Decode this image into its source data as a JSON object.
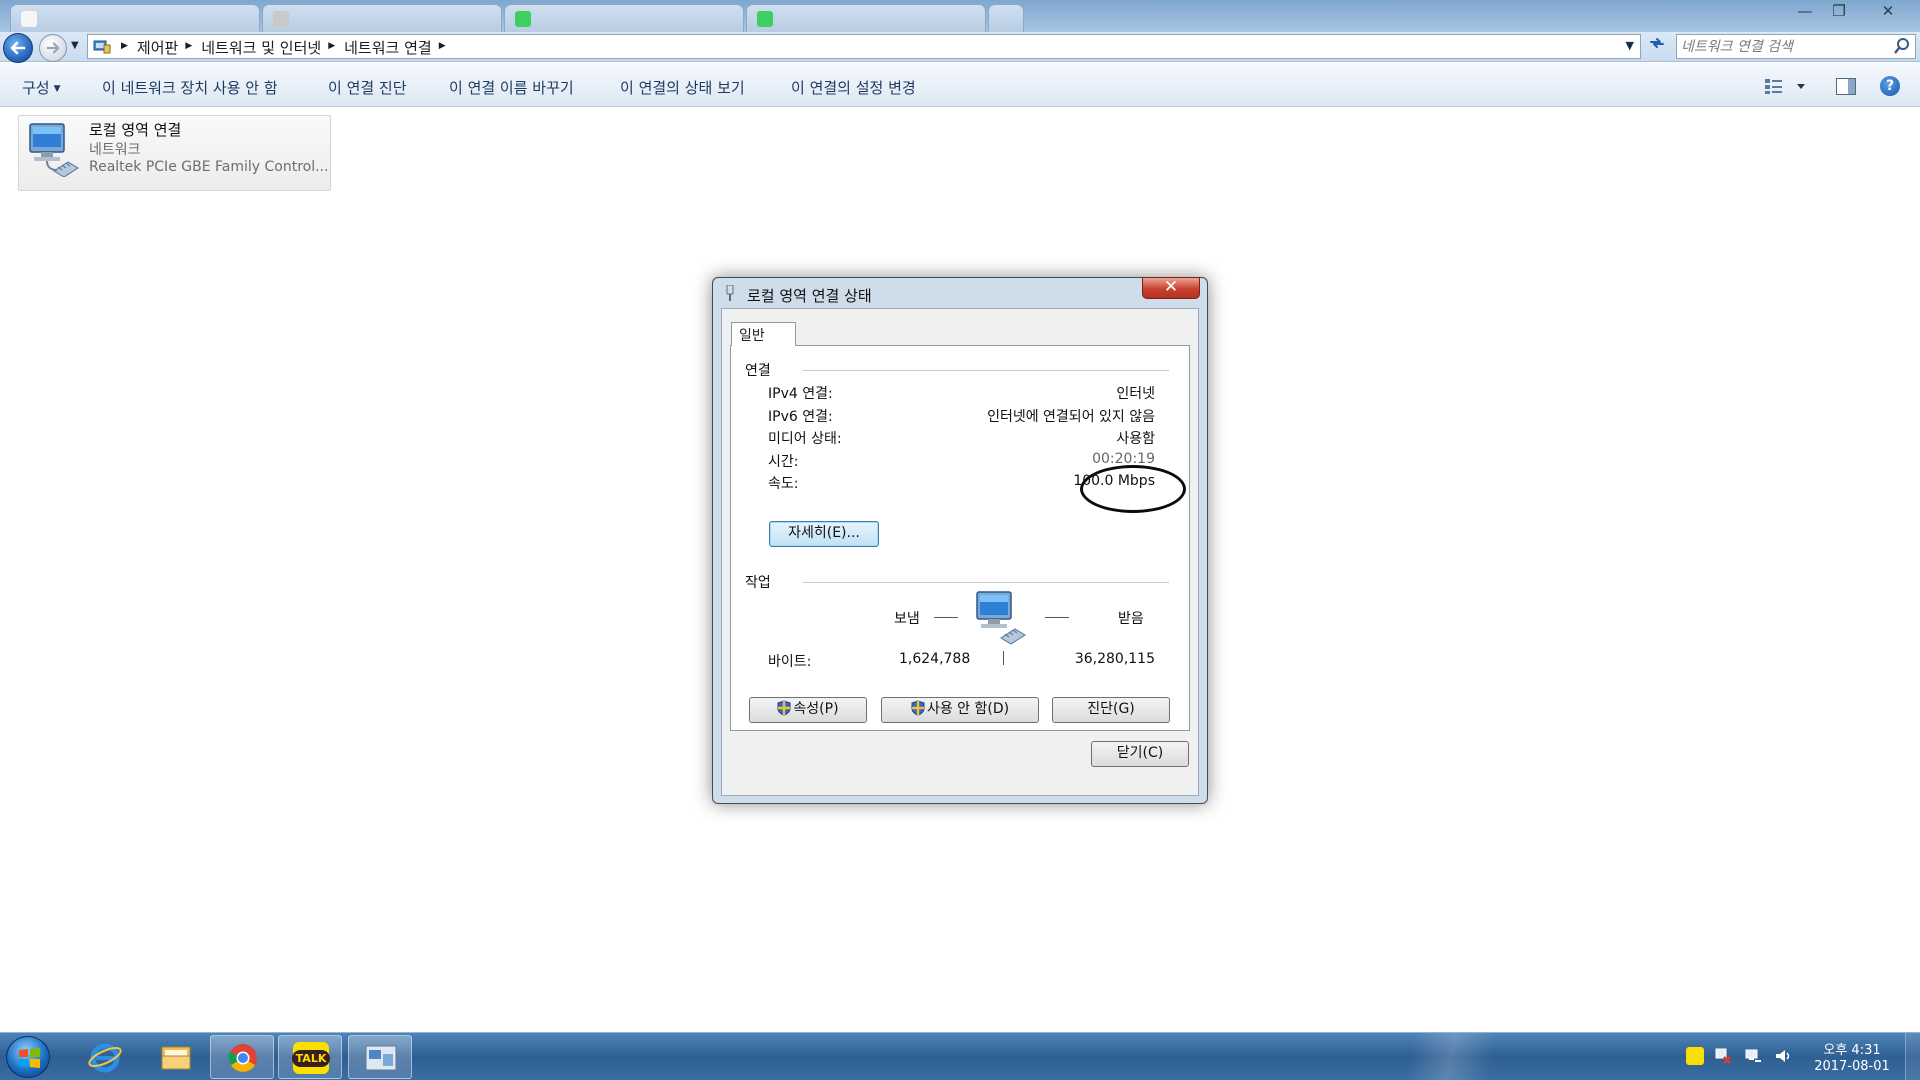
{
  "window": {
    "controls": {
      "minimize": "—",
      "maximize": "❐",
      "close": "✕"
    }
  },
  "address_bar": {
    "breadcrumbs": [
      "제어판",
      "네트워크 및 인터넷",
      "네트워크 연결"
    ],
    "search_placeholder": "네트워크 연결 검색"
  },
  "command_bar": {
    "organize": "구성",
    "items": [
      "이 네트워크 장치 사용 안 함",
      "이 연결 진단",
      "이 연결 이름 바꾸기",
      "이 연결의 상태 보기",
      "이 연결의 설정 변경"
    ],
    "help": "?"
  },
  "connection": {
    "name": "로컬 영역 연결",
    "type": "네트워크",
    "adapter": "Realtek PCIe GBE Family Control..."
  },
  "dialog": {
    "title": "로컬 영역 연결 상태",
    "close": "✕",
    "tab": "일반",
    "connection_group": "연결",
    "rows": [
      {
        "label": "IPv4 연결:",
        "value": "인터넷"
      },
      {
        "label": "IPv6 연결:",
        "value": "인터넷에 연결되어 있지 않음"
      },
      {
        "label": "미디어 상태:",
        "value": "사용함"
      },
      {
        "label": "시간:",
        "value": "00:20:19"
      },
      {
        "label": "속도:",
        "value": "100.0 Mbps"
      }
    ],
    "details_button": "자세히(E)...",
    "activity_group": "작업",
    "sent_label": "보냄",
    "received_label": "받음",
    "bytes_label": "바이트:",
    "bytes_sent": "1,624,788",
    "bytes_received": "36,280,115",
    "properties_button": "속성(P)",
    "disable_button": "사용 안 함(D)",
    "diagnose_button": "진단(G)",
    "close_button": "닫기(C)"
  },
  "taskbar": {
    "apps": [
      "start",
      "internet-explorer",
      "file-explorer",
      "chrome",
      "kakaotalk",
      "network-connections"
    ],
    "kakao_label": "TALK",
    "clock_time": "오후 4:31",
    "clock_date": "2017-08-01"
  },
  "colors": {
    "accent": "#1e5fb6",
    "close_red": "#c8422e",
    "taskbar": "#2f5f92",
    "kakao_yellow": "#f9e000"
  }
}
